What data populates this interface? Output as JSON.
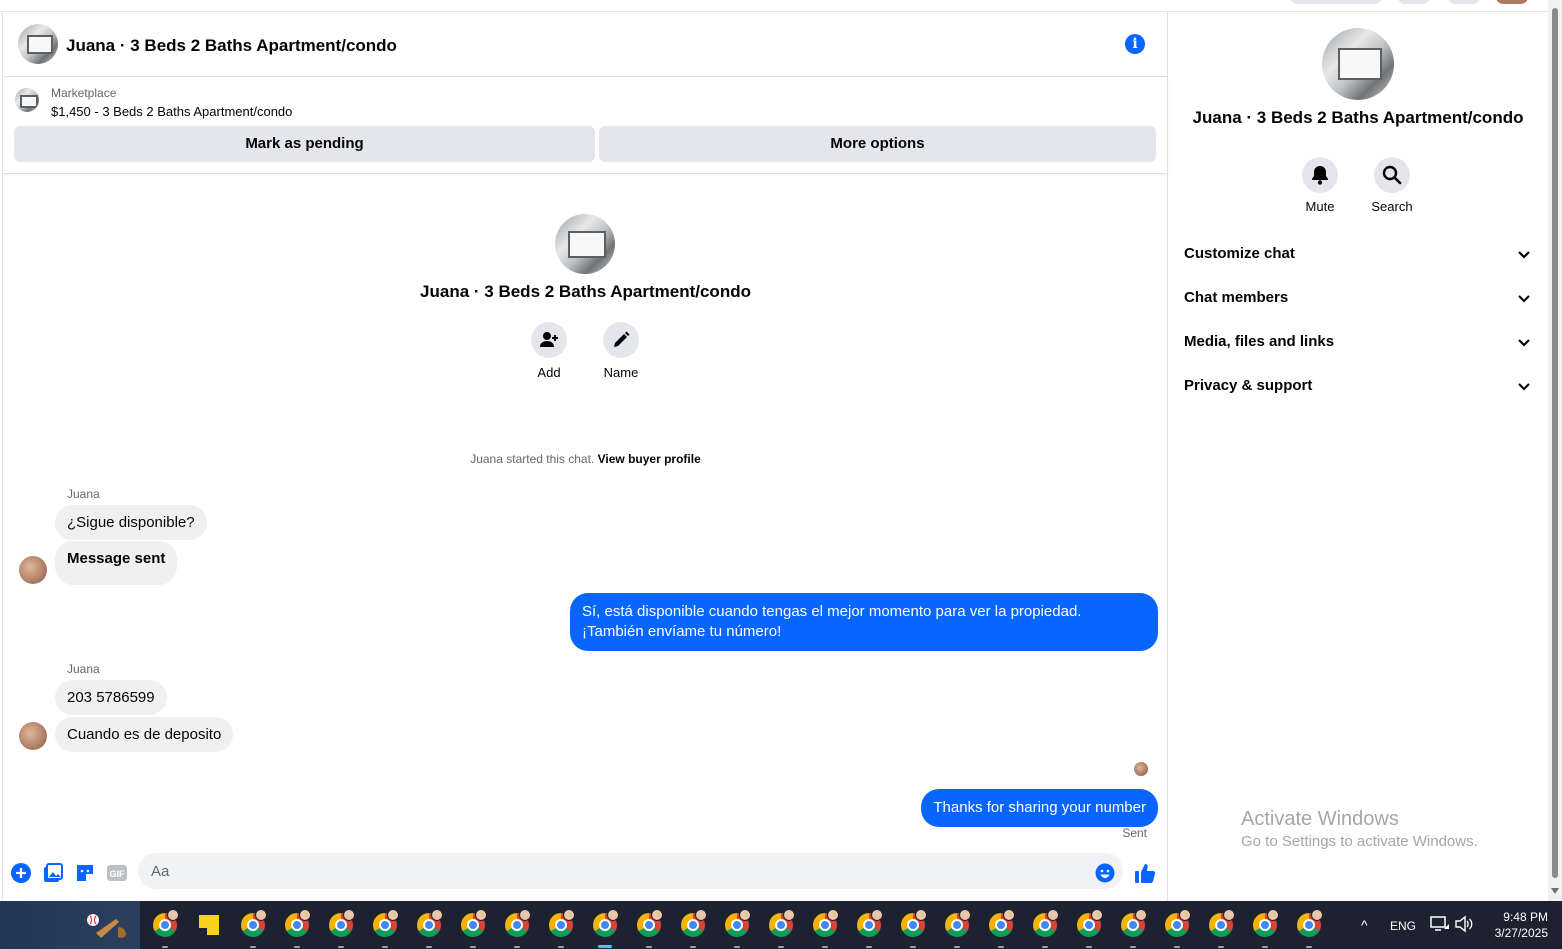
{
  "chat": {
    "title": "Juana · 3 Beds 2 Baths Apartment/condo",
    "marketplace_label": "Marketplace",
    "listing_line": "$1,450 - 3 Beds 2 Baths Apartment/condo",
    "mark_pending_label": "Mark as pending",
    "more_options_label": "More options"
  },
  "intro": {
    "title": "Juana · 3 Beds 2 Baths Apartment/condo",
    "add_label": "Add",
    "name_label": "Name",
    "started_text": "Juana started this chat.",
    "view_profile_label": "View buyer profile"
  },
  "messages": {
    "group1_sender": "Juana",
    "msg1": "¿Sigue disponible?",
    "msg2": "Message sent",
    "out1": "Sí, está disponible cuando tengas el mejor momento para ver la propiedad. ¡También envíame tu número!",
    "group2_sender": "Juana",
    "msg3": "203 5786599",
    "msg4": "Cuando es de deposito",
    "out2": "Thanks for sharing your number",
    "sent_status": "Sent"
  },
  "composer": {
    "placeholder": "Aa",
    "icons": [
      "plus-icon",
      "photo-icon",
      "sticker-icon",
      "gif-icon",
      "emoji-icon",
      "like-icon"
    ],
    "gif_text": "GIF"
  },
  "side": {
    "title": "Juana · 3 Beds 2 Baths Apartment/condo",
    "mute_label": "Mute",
    "search_label": "Search",
    "sections": [
      "Customize chat",
      "Chat members",
      "Media, files and links",
      "Privacy & support"
    ]
  },
  "watermark": {
    "line1": "Activate Windows",
    "line2": "Go to Settings to activate Windows."
  },
  "taskbar": {
    "language": "ENG",
    "time": "9:48 PM",
    "date": "3/27/2025"
  },
  "colors": {
    "accent": "#0866ff",
    "bubble_in": "#f0f0f0",
    "button_bg": "#e4e6eb",
    "taskbar_bg": "#1c2230"
  }
}
